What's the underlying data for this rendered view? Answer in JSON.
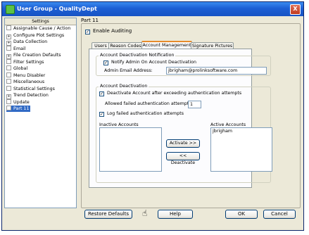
{
  "window": {
    "title": "User Group - QualityDept",
    "close_glyph": "X"
  },
  "tree": {
    "header": "Settings",
    "items": [
      {
        "label": "Assignable Cause / Action",
        "expander": ""
      },
      {
        "label": "Configure Plot Settings",
        "expander": "+"
      },
      {
        "label": "Data Collection",
        "expander": "+"
      },
      {
        "label": "Email",
        "expander": ""
      },
      {
        "label": "File Creation Defaults",
        "expander": "+"
      },
      {
        "label": "Filter Settings",
        "expander": ""
      },
      {
        "label": "Global",
        "expander": ""
      },
      {
        "label": "Menu Disabler",
        "expander": ""
      },
      {
        "label": "Miscellaneous",
        "expander": ""
      },
      {
        "label": "Statistical Settings",
        "expander": ""
      },
      {
        "label": "Trend Detection",
        "expander": "+"
      },
      {
        "label": "Update",
        "expander": ""
      },
      {
        "label": "Part 11",
        "expander": "",
        "selected": true
      }
    ]
  },
  "panel": {
    "title": "Part 11",
    "enable_auditing_label": "Enable Auditing",
    "enable_auditing_checked": "✓",
    "tabs": [
      "Users",
      "Reason Codes",
      "Account Management",
      "Signature Pictures"
    ],
    "active_tab": "Account Management"
  },
  "notification": {
    "legend": "Account Deactivation Notification",
    "notify_label": "Notify Admin On Account Deactivation",
    "notify_checked": "✓",
    "email_label": "Admin Email Address:",
    "email_value": "jbrigham@prolinksoftware.com"
  },
  "deactivation": {
    "legend": "Account Deactivation",
    "deactivate_label": "Deactivate Account after exceeding authentication attempts",
    "deactivate_checked": "✓",
    "allowed_label": "Allowed failed authentication attempts:",
    "allowed_value": "1",
    "log_label": "Log failed authentication attempts",
    "log_checked": "✓",
    "inactive_label": "Inactive Accounts",
    "inactive_items": [],
    "active_label": "Active Accounts",
    "active_items": [
      "jbrigham"
    ],
    "activate_button": "Activate >>",
    "deactivate_button": "<< Deactivate"
  },
  "footer": {
    "restore_button": "Restore Defaults",
    "help_button": "Help",
    "ok_button": "OK",
    "cancel_button": "Cancel"
  }
}
